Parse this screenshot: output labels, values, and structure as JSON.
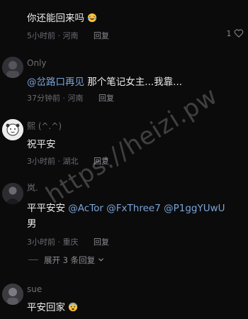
{
  "comments": [
    {
      "username": "",
      "text": "你还能回来吗",
      "emoji": "laughing-crying",
      "time": "5小时前",
      "location": "河南",
      "reply_label": "回复",
      "like_count": "1"
    },
    {
      "username": "Only",
      "mention": "@岔路口再见",
      "text": "那个笔记女主...我靠...",
      "time": "37分钟前",
      "location": "河南",
      "reply_label": "回复"
    },
    {
      "username": "熙 (^.^)",
      "text": "祝平安",
      "time": "3小时前",
      "location": "湖北",
      "reply_label": "回复"
    },
    {
      "username": "岚.",
      "text_prefix": "平平安安",
      "mentions": [
        "@AcTor",
        "@FxThree7",
        "@P1ggYUwU"
      ],
      "text_suffix": "男",
      "time": "3小时前",
      "location": "重庆",
      "reply_label": "回复",
      "expand_label": "展开 3 条回复"
    },
    {
      "username": "sue",
      "text": "平安回家",
      "emoji": "fearful-face",
      "time": "",
      "location": "",
      "reply_label": ""
    }
  ],
  "watermark": "https://heizi.pw",
  "colors": {
    "background": "#0b0b0c",
    "mention": "#7aa3d6",
    "meta": "#6c6c72"
  }
}
